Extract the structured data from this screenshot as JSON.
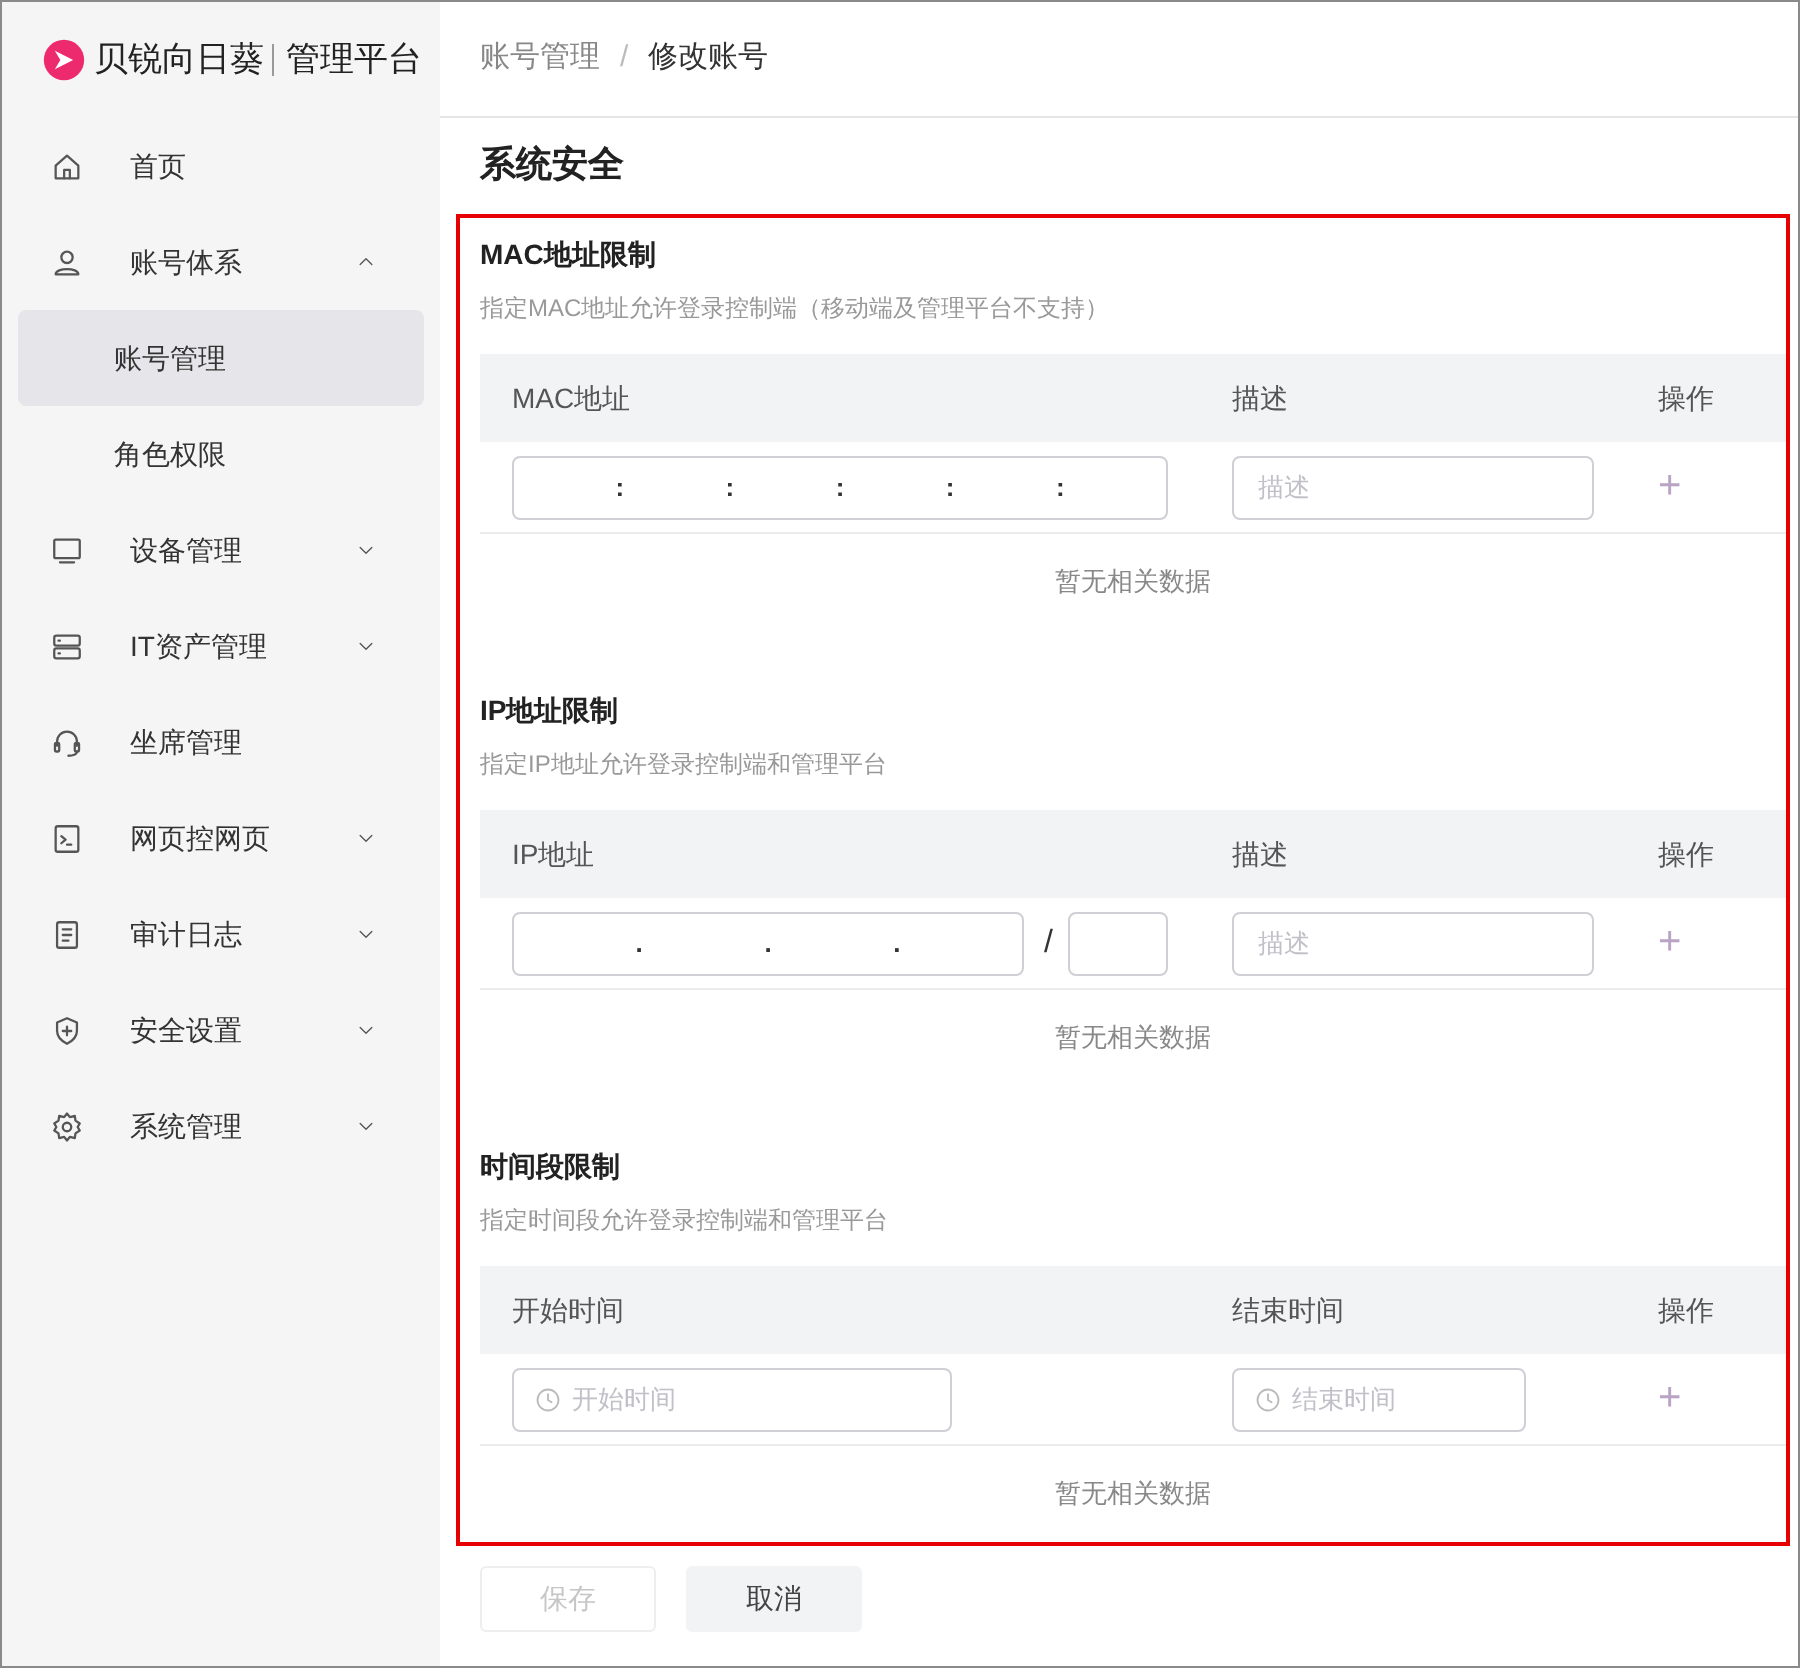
{
  "logo": {
    "brand": "贝锐向日葵",
    "product": "管理平台"
  },
  "sidebar": {
    "items": [
      {
        "label": "首页",
        "kind": "link",
        "selected": false
      },
      {
        "label": "账号体系",
        "kind": "group",
        "expanded": true,
        "selected": false,
        "children": [
          {
            "label": "账号管理",
            "selected": true
          },
          {
            "label": "角色权限",
            "selected": false
          }
        ]
      },
      {
        "label": "设备管理",
        "kind": "group",
        "expanded": false,
        "selected": false
      },
      {
        "label": "IT资产管理",
        "kind": "group",
        "expanded": false,
        "selected": false
      },
      {
        "label": "坐席管理",
        "kind": "link",
        "selected": false
      },
      {
        "label": "网页控网页",
        "kind": "group",
        "expanded": false,
        "selected": false
      },
      {
        "label": "审计日志",
        "kind": "group",
        "expanded": false,
        "selected": false
      },
      {
        "label": "安全设置",
        "kind": "group",
        "expanded": false,
        "selected": false
      },
      {
        "label": "系统管理",
        "kind": "group",
        "expanded": false,
        "selected": false
      }
    ]
  },
  "breadcrumb": {
    "items": [
      "账号管理",
      "修改账号"
    ],
    "separator": "/"
  },
  "page_title": "系统安全",
  "sections": [
    {
      "title": "MAC地址限制",
      "description": "指定MAC地址允许登录控制端（移动端及管理平台不支持）",
      "columns": [
        "MAC地址",
        "描述",
        "操作"
      ],
      "input_row": {
        "kind": "mac",
        "separators": [
          ":",
          ":",
          ":",
          ":",
          ":"
        ],
        "description_placeholder": "描述",
        "add": "+"
      },
      "empty_text": "暂无相关数据"
    },
    {
      "title": "IP地址限制",
      "description": "指定IP地址允许登录控制端和管理平台",
      "columns": [
        "IP地址",
        "描述",
        "操作"
      ],
      "input_row": {
        "kind": "ip",
        "separators": [
          ".",
          ".",
          "."
        ],
        "mask_separator": "/",
        "description_placeholder": "描述",
        "add": "+"
      },
      "empty_text": "暂无相关数据"
    },
    {
      "title": "时间段限制",
      "description": "指定时间段允许登录控制端和管理平台",
      "columns": [
        "开始时间",
        "结束时间",
        "操作"
      ],
      "input_row": {
        "kind": "time",
        "start_placeholder": "开始时间",
        "end_placeholder": "结束时间",
        "add": "+"
      },
      "empty_text": "暂无相关数据"
    }
  ],
  "buttons": [
    {
      "label": "保存",
      "kind": "primary",
      "disabled": true
    },
    {
      "label": "取消",
      "kind": "secondary",
      "disabled": false
    }
  ]
}
